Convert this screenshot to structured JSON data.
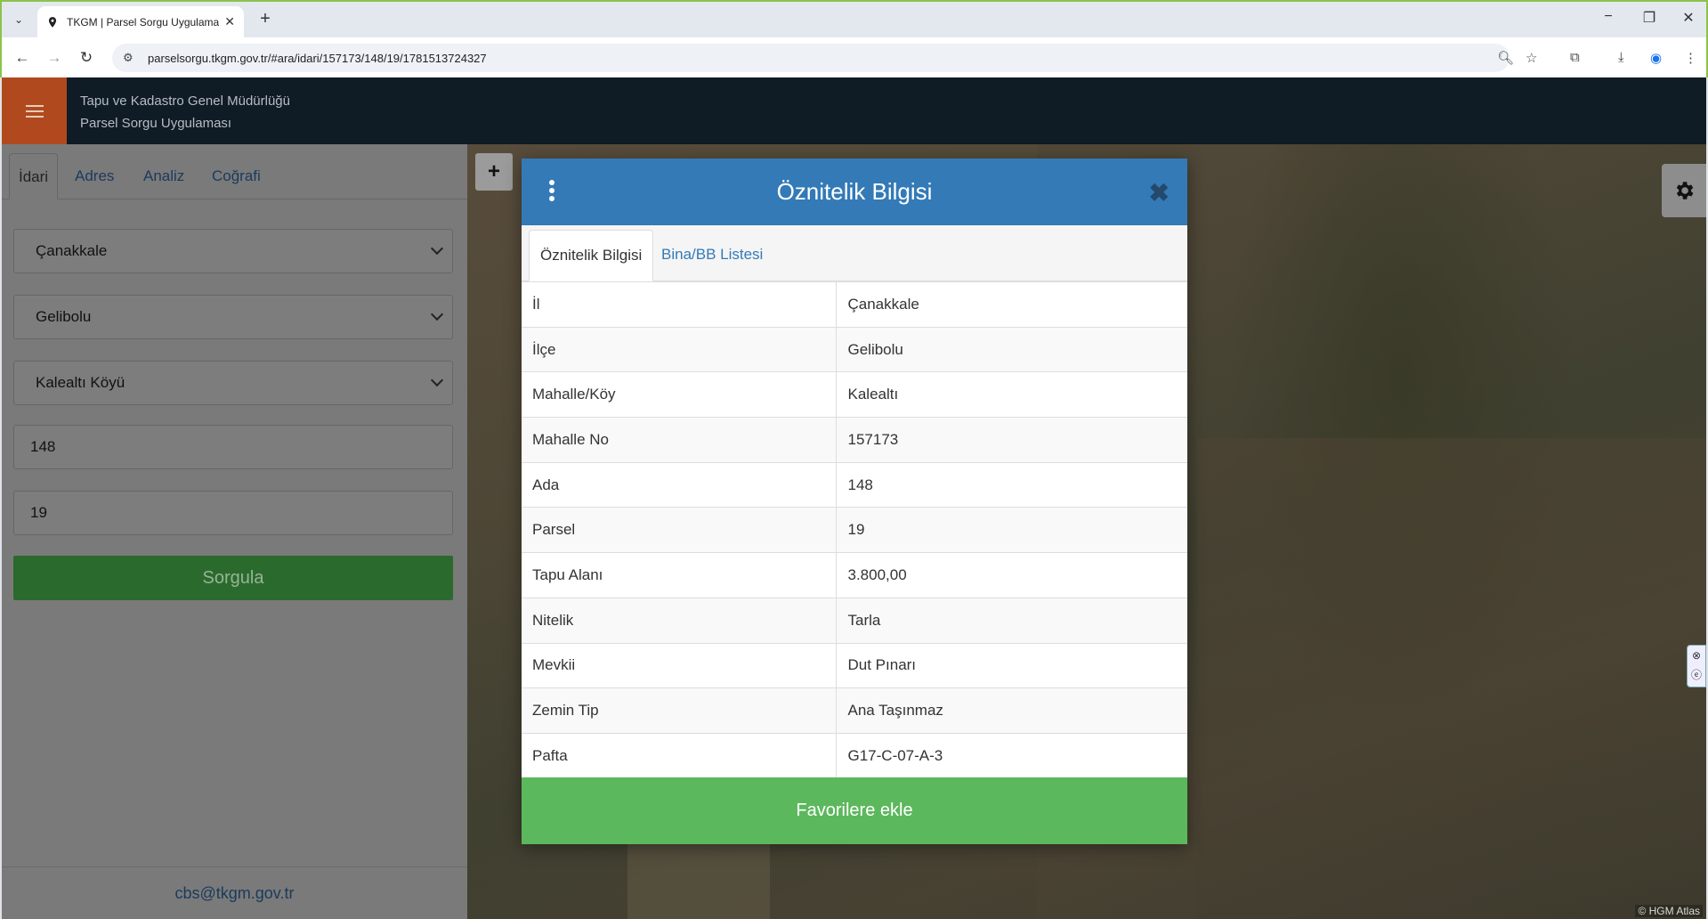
{
  "browser": {
    "tab_title": "TKGM | Parsel Sorgu Uygulaması",
    "new_tab": "+",
    "url": "parselsorgu.tkgm.gov.tr/#ara/idari/157173/148/19/1781513724327",
    "win_min": "−",
    "win_restore": "❐",
    "win_close": "✕"
  },
  "app": {
    "org_name": "Tapu ve Kadastro Genel Müdürlüğü",
    "app_name": "Parsel Sorgu Uygulaması"
  },
  "left_panel": {
    "tabs": [
      "İdari",
      "Adres",
      "Analiz",
      "Coğrafi"
    ],
    "il": "Çanakkale",
    "ilce": "Gelibolu",
    "mahalle": "Kalealtı Köyü",
    "ada": "148",
    "parsel": "19",
    "sorgula_label": "Sorgula",
    "footer_email": "cbs@tkgm.gov.tr"
  },
  "map": {
    "zoom_in": "+",
    "attribution": "© HGM Atlas"
  },
  "modal": {
    "title": "Öznitelik Bilgisi",
    "close": "✖",
    "tabs": [
      "Öznitelik Bilgisi",
      "Bina/BB Listesi"
    ],
    "rows": [
      {
        "key": "İl",
        "value": "Çanakkale"
      },
      {
        "key": "İlçe",
        "value": "Gelibolu"
      },
      {
        "key": "Mahalle/Köy",
        "value": "Kalealtı"
      },
      {
        "key": "Mahalle No",
        "value": "157173"
      },
      {
        "key": "Ada",
        "value": "148"
      },
      {
        "key": "Parsel",
        "value": "19"
      },
      {
        "key": "Tapu Alanı",
        "value": "3.800,00"
      },
      {
        "key": "Nitelik",
        "value": "Tarla"
      },
      {
        "key": "Mevkii",
        "value": "Dut Pınarı"
      },
      {
        "key": "Zemin Tip",
        "value": "Ana Taşınmaz"
      },
      {
        "key": "Pafta",
        "value": "G17-C-07-A-3"
      }
    ],
    "favorite_label": "Favorilere ekle"
  },
  "colors": {
    "header_bg": "#0f1b25",
    "hamburger_bg": "#b04a1e",
    "modal_header": "#337ab7",
    "favorite_btn": "#5cb85c",
    "sorgula_btn": "#2b6a2d"
  }
}
